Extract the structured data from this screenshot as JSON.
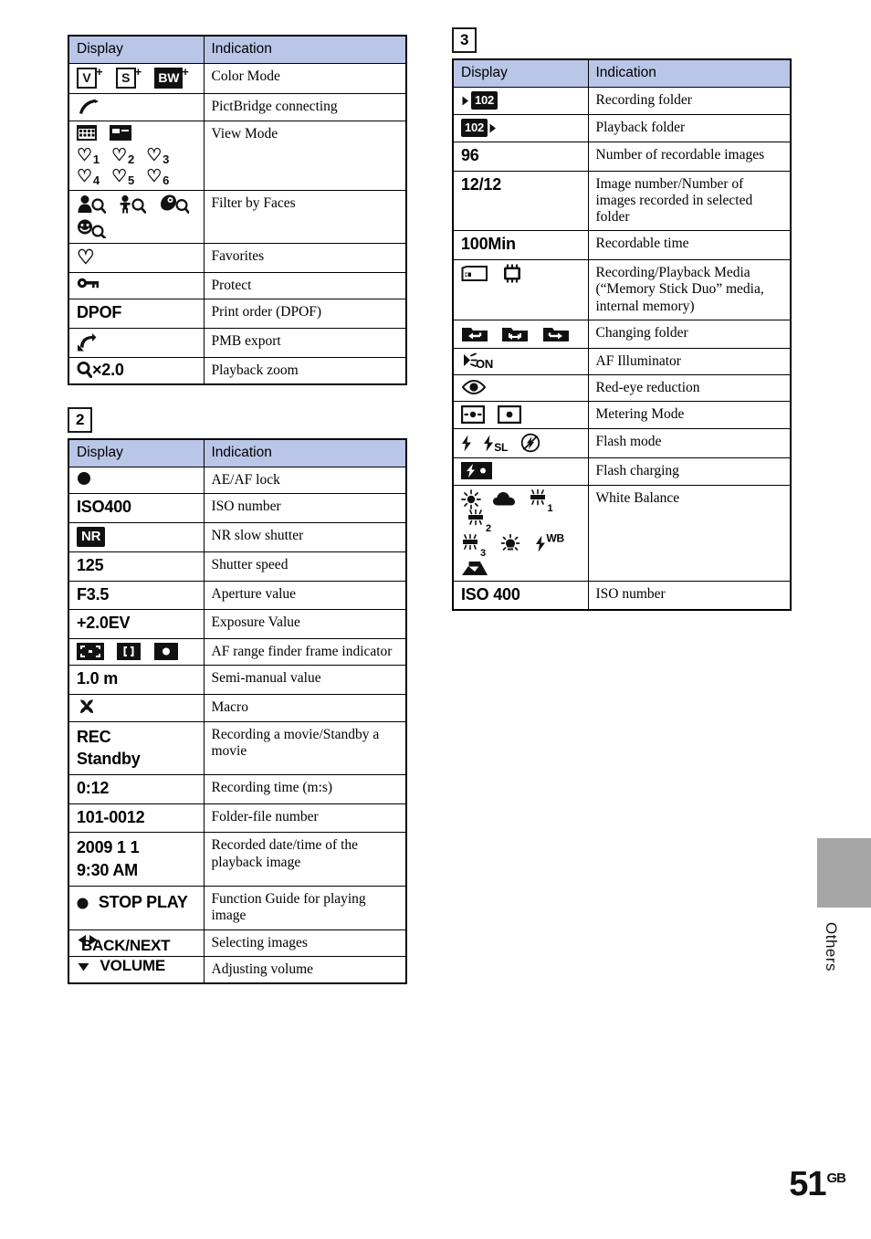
{
  "page": {
    "number": "51",
    "region": "GB",
    "side_tab_label": "Others",
    "accent_header_color": "#b9c6e8",
    "side_tab_color": "#a6a6a6"
  },
  "tables": [
    {
      "id": "table-1",
      "section_badge": "",
      "headers": {
        "display": "Display",
        "indication": "Indication"
      },
      "rows": [
        {
          "display_text": "",
          "icons": [
            "color-mode-vivid",
            "color-mode-sepia",
            "color-mode-bw"
          ],
          "indication": "Color Mode"
        },
        {
          "display_text": "",
          "icons": [
            "pictbridge-icon"
          ],
          "indication": "PictBridge connecting"
        },
        {
          "display_text": "",
          "icons": [
            "calendar-icon",
            "filmstrip-icon",
            "heart-1",
            "heart-2",
            "heart-3",
            "heart-4",
            "heart-5",
            "heart-6"
          ],
          "indication": "View Mode"
        },
        {
          "display_text": "",
          "icons": [
            "face-adult-search",
            "face-child-search",
            "face-baby-search",
            "face-smile-search"
          ],
          "indication": "Filter by Faces"
        },
        {
          "display_text": "",
          "icons": [
            "heart-icon"
          ],
          "indication": "Favorites"
        },
        {
          "display_text": "",
          "icons": [
            "key-icon"
          ],
          "indication": "Protect"
        },
        {
          "display_text": "DPOF",
          "icons": [],
          "indication": "Print order (DPOF)"
        },
        {
          "display_text": "",
          "icons": [
            "pmb-export-icon"
          ],
          "indication": "PMB export"
        },
        {
          "display_text": "×2.0",
          "icons": [
            "magnifier-icon"
          ],
          "indication": "Playback zoom"
        }
      ]
    },
    {
      "id": "table-2",
      "section_badge": "2",
      "headers": {
        "display": "Display",
        "indication": "Indication"
      },
      "rows": [
        {
          "display_text": "",
          "icons": [
            "filled-circle-icon"
          ],
          "indication": "AE/AF lock"
        },
        {
          "display_text": "ISO400",
          "icons": [],
          "indication": "ISO number"
        },
        {
          "display_text": "NR",
          "icons": [
            "nr-box-icon"
          ],
          "indication": "NR slow shutter"
        },
        {
          "display_text": "125",
          "icons": [],
          "indication": "Shutter speed"
        },
        {
          "display_text": "F3.5",
          "icons": [],
          "indication": "Aperture value"
        },
        {
          "display_text": "+2.0EV",
          "icons": [],
          "indication": "Exposure Value"
        },
        {
          "display_text": "",
          "icons": [
            "af-frame-corners",
            "af-frame-brackets",
            "af-frame-dot"
          ],
          "indication": "AF range finder frame indicator"
        },
        {
          "display_text": "1.0 m",
          "icons": [],
          "indication": "Semi-manual value"
        },
        {
          "display_text": "",
          "icons": [
            "macro-flower-icon"
          ],
          "indication": "Macro"
        },
        {
          "display_text": "REC\nStandby",
          "icons": [],
          "indication": "Recording a movie/Standby a movie"
        },
        {
          "display_text": "0:12",
          "icons": [],
          "indication": "Recording time (m:s)"
        },
        {
          "display_text": "101-0012",
          "icons": [],
          "indication": "Folder-file number"
        },
        {
          "display_text": "2009 1 1\n9:30 AM",
          "icons": [],
          "indication": "Recorded date/time of the playback image"
        },
        {
          "display_text": "STOP\nPLAY",
          "icons": [
            "filled-circle-icon"
          ],
          "indication": "Function Guide for playing image"
        },
        {
          "display_text": "BACK/NEXT",
          "icons": [
            "left-right-arrow-icon"
          ],
          "indication": "Selecting images"
        },
        {
          "display_text": "VOLUME",
          "icons": [
            "down-arrow-icon"
          ],
          "indication": "Adjusting volume"
        }
      ]
    },
    {
      "id": "table-3",
      "section_badge": "3",
      "headers": {
        "display": "Display",
        "indication": "Indication"
      },
      "rows": [
        {
          "display_text": "102",
          "icons": [
            "recording-folder-icon"
          ],
          "indication": "Recording folder"
        },
        {
          "display_text": "102",
          "icons": [
            "playback-folder-icon"
          ],
          "indication": "Playback folder"
        },
        {
          "display_text": "96",
          "icons": [],
          "indication": "Number of recordable images"
        },
        {
          "display_text": "12/12",
          "icons": [],
          "indication": "Image number/Number of images recorded in selected folder"
        },
        {
          "display_text": "100Min",
          "icons": [],
          "indication": "Recordable time"
        },
        {
          "display_text": "",
          "icons": [
            "memory-stick-icon",
            "internal-memory-chip-icon"
          ],
          "indication": "Recording/Playback Media (“Memory Stick Duo” media, internal memory)"
        },
        {
          "display_text": "",
          "icons": [
            "folder-back-icon",
            "folder-both-icon",
            "folder-next-icon"
          ],
          "indication": "Changing folder"
        },
        {
          "display_text": "ON",
          "icons": [
            "af-illuminator-icon"
          ],
          "indication": "AF Illuminator"
        },
        {
          "display_text": "",
          "icons": [
            "red-eye-reduction-icon"
          ],
          "indication": "Red-eye reduction"
        },
        {
          "display_text": "",
          "icons": [
            "metering-multi-icon",
            "metering-spot-icon"
          ],
          "indication": "Metering Mode"
        },
        {
          "display_text": "SL",
          "icons": [
            "flash-on-icon",
            "flash-slow-sync-icon",
            "flash-off-icon"
          ],
          "indication": "Flash mode"
        },
        {
          "display_text": "",
          "icons": [
            "flash-charging-icon"
          ],
          "indication": "Flash charging"
        },
        {
          "display_text": "",
          "icons": [
            "wb-daylight-icon",
            "wb-cloudy-icon",
            "wb-fluorescent-1-icon",
            "wb-fluorescent-2-icon",
            "wb-fluorescent-3-icon",
            "wb-incandescent-icon",
            "wb-flash-icon",
            "wb-one-push-icon"
          ],
          "indication": "White Balance"
        },
        {
          "display_text": "ISO 400",
          "icons": [],
          "indication": "ISO number"
        }
      ]
    }
  ]
}
